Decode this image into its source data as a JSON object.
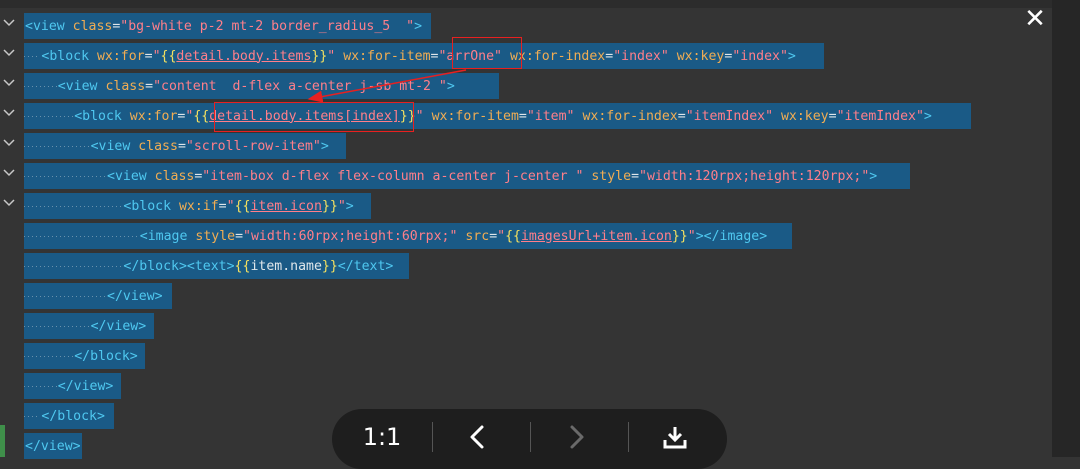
{
  "viewer": {
    "close_label": "✕",
    "toolbar": {
      "ratio_label": "1:1",
      "prev_icon": "chevron-left-icon",
      "next_icon": "chevron-right-icon",
      "download_icon": "download-icon"
    }
  },
  "code": {
    "lines": [
      {
        "indent": 0,
        "tokens": [
          [
            "tag",
            "<view "
          ],
          [
            "attr",
            "class"
          ],
          [
            "eq",
            "="
          ],
          [
            "str",
            "\"bg-white p-2 mt-2 border_radius_5  \""
          ],
          [
            "tag",
            ">"
          ]
        ]
      },
      {
        "indent": 1,
        "tokens": [
          [
            "tag",
            "<block "
          ],
          [
            "attr",
            "wx:for"
          ],
          [
            "eq",
            "="
          ],
          [
            "str",
            "\""
          ],
          [
            "br",
            "{{"
          ],
          [
            "expr",
            "detail.body.items"
          ],
          [
            "br",
            "}}"
          ],
          [
            "str",
            "\""
          ],
          [
            "tag",
            " "
          ],
          [
            "attr",
            "wx:for-item"
          ],
          [
            "eq",
            "="
          ],
          [
            "str",
            "\"arrOne\""
          ],
          [
            "tag",
            " "
          ],
          [
            "attr",
            "wx:for-index"
          ],
          [
            "eq",
            "="
          ],
          [
            "str",
            "\"index\""
          ],
          [
            "tag",
            " "
          ],
          [
            "attr",
            "wx:key"
          ],
          [
            "eq",
            "="
          ],
          [
            "str",
            "\"index\""
          ],
          [
            "tag",
            ">"
          ]
        ]
      },
      {
        "indent": 2,
        "tokens": [
          [
            "tag",
            "<view "
          ],
          [
            "attr",
            "class"
          ],
          [
            "eq",
            "="
          ],
          [
            "str",
            "\"content  d-flex a-center j-sb mt-2 \""
          ],
          [
            "tag",
            ">"
          ]
        ]
      },
      {
        "indent": 3,
        "tokens": [
          [
            "tag",
            "<block "
          ],
          [
            "attr",
            "wx:for"
          ],
          [
            "eq",
            "="
          ],
          [
            "str",
            "\""
          ],
          [
            "br",
            "{{"
          ],
          [
            "expr",
            "detail.body.items[index]"
          ],
          [
            "br",
            "}}"
          ],
          [
            "str",
            "\""
          ],
          [
            "tag",
            " "
          ],
          [
            "attr",
            "wx:for-item"
          ],
          [
            "eq",
            "="
          ],
          [
            "str",
            "\"item\""
          ],
          [
            "tag",
            " "
          ],
          [
            "attr",
            "wx:for-index"
          ],
          [
            "eq",
            "="
          ],
          [
            "str",
            "\"itemIndex\""
          ],
          [
            "tag",
            " "
          ],
          [
            "attr",
            "wx:key"
          ],
          [
            "eq",
            "="
          ],
          [
            "str",
            "\"itemIndex\""
          ],
          [
            "tag",
            ">"
          ]
        ]
      },
      {
        "indent": 4,
        "tokens": [
          [
            "tag",
            "<view "
          ],
          [
            "attr",
            "class"
          ],
          [
            "eq",
            "="
          ],
          [
            "str",
            "\"scroll-row-item\""
          ],
          [
            "tag",
            ">"
          ]
        ]
      },
      {
        "indent": 5,
        "tokens": [
          [
            "tag",
            "<view "
          ],
          [
            "attr",
            "class"
          ],
          [
            "eq",
            "="
          ],
          [
            "str",
            "\"item-box d-flex flex-column a-center j-center \""
          ],
          [
            "tag",
            " "
          ],
          [
            "attr",
            "style"
          ],
          [
            "eq",
            "="
          ],
          [
            "str",
            "\"width:120rpx;height:120rpx;\""
          ],
          [
            "tag",
            ">"
          ]
        ]
      },
      {
        "indent": 6,
        "tokens": [
          [
            "tag",
            "<block "
          ],
          [
            "attr",
            "wx:if"
          ],
          [
            "eq",
            "="
          ],
          [
            "str",
            "\""
          ],
          [
            "br",
            "{{"
          ],
          [
            "expr",
            "item.icon"
          ],
          [
            "br",
            "}}"
          ],
          [
            "str",
            "\""
          ],
          [
            "tag",
            ">"
          ]
        ]
      },
      {
        "indent": 7,
        "tokens": [
          [
            "tag",
            "<image "
          ],
          [
            "attr",
            "style"
          ],
          [
            "eq",
            "="
          ],
          [
            "str",
            "\"width:60rpx;height:60rpx;\""
          ],
          [
            "tag",
            " "
          ],
          [
            "attr",
            "src"
          ],
          [
            "eq",
            "="
          ],
          [
            "str",
            "\""
          ],
          [
            "br",
            "{{"
          ],
          [
            "expr",
            "imagesUrl+item.icon"
          ],
          [
            "br",
            "}}"
          ],
          [
            "str",
            "\""
          ],
          [
            "tag",
            "></image>"
          ]
        ]
      },
      {
        "indent": 6,
        "tokens": [
          [
            "tag",
            "</block><text>"
          ],
          [
            "br",
            "{{"
          ],
          [
            "eq",
            "item.name"
          ],
          [
            "br",
            "}}"
          ],
          [
            "tag",
            "</text>"
          ]
        ]
      },
      {
        "indent": 5,
        "tokens": [
          [
            "tag",
            "</view>"
          ]
        ]
      },
      {
        "indent": 4,
        "tokens": [
          [
            "tag",
            "</view>"
          ]
        ]
      },
      {
        "indent": 3,
        "tokens": [
          [
            "tag",
            "</block>"
          ]
        ]
      },
      {
        "indent": 2,
        "tokens": [
          [
            "tag",
            "</view>"
          ]
        ]
      },
      {
        "indent": 1,
        "tokens": [
          [
            "tag",
            "</block>"
          ]
        ]
      },
      {
        "indent": 0,
        "tokens": [
          [
            "tag",
            "</view>"
          ]
        ]
      }
    ]
  },
  "colors": {
    "selection": "#1a5a86",
    "tag": "#4fc8f0",
    "attribute": "#f1ad53",
    "string": "#ff7f8a",
    "brace": "#f5e160",
    "annotation": "#e82020"
  }
}
